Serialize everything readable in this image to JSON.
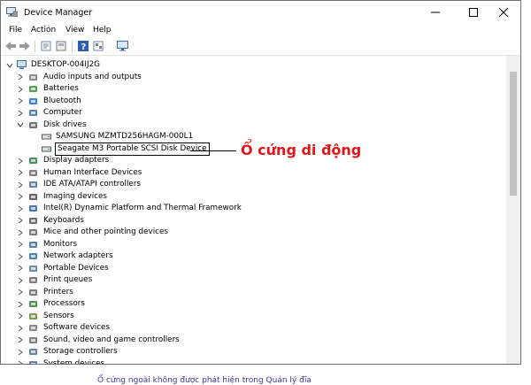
{
  "window": {
    "title": "Device Manager"
  },
  "menu": [
    "File",
    "Action",
    "View",
    "Help"
  ],
  "toolbar": {
    "buttons": [
      "back-arrow-icon",
      "forward-arrow-icon",
      "properties-icon",
      "details-icon",
      "help-icon",
      "show-hidden-icon",
      "monitor-icon"
    ]
  },
  "tree": {
    "root": "DESKTOP-004IJ2G",
    "categories": [
      {
        "label": "Audio inputs and outputs",
        "icon": "speaker-icon"
      },
      {
        "label": "Batteries",
        "icon": "battery-icon"
      },
      {
        "label": "Bluetooth",
        "icon": "bluetooth-icon"
      },
      {
        "label": "Computer",
        "icon": "computer-icon"
      },
      {
        "label": "Disk drives",
        "icon": "disk-drive-icon",
        "expanded": true,
        "children": [
          "SAMSUNG MZMTD256HAGM-000L1",
          "Seagate M3 Portable SCSI Disk Device"
        ]
      },
      {
        "label": "Display adapters",
        "icon": "display-adapter-icon"
      },
      {
        "label": "Human Interface Devices",
        "icon": "hid-icon"
      },
      {
        "label": "IDE ATA/ATAPI controllers",
        "icon": "ide-controller-icon"
      },
      {
        "label": "Imaging devices",
        "icon": "camera-icon"
      },
      {
        "label": "Intel(R) Dynamic Platform and Thermal Framework",
        "icon": "intel-icon"
      },
      {
        "label": "Keyboards",
        "icon": "keyboard-icon"
      },
      {
        "label": "Mice and other pointing devices",
        "icon": "mouse-icon"
      },
      {
        "label": "Monitors",
        "icon": "monitor-icon"
      },
      {
        "label": "Network adapters",
        "icon": "network-icon"
      },
      {
        "label": "Portable Devices",
        "icon": "portable-device-icon"
      },
      {
        "label": "Print queues",
        "icon": "printer-icon"
      },
      {
        "label": "Printers",
        "icon": "printer-icon"
      },
      {
        "label": "Processors",
        "icon": "processor-icon"
      },
      {
        "label": "Sensors",
        "icon": "sensor-icon"
      },
      {
        "label": "Software devices",
        "icon": "software-device-icon"
      },
      {
        "label": "Sound, video and game controllers",
        "icon": "sound-icon"
      },
      {
        "label": "Storage controllers",
        "icon": "storage-icon"
      },
      {
        "label": "System devices",
        "icon": "system-icon"
      }
    ],
    "selected": "Seagate M3 Portable SCSI Disk Device"
  },
  "annotation": {
    "text": "Ổ cứng di động",
    "color": "#e01515"
  },
  "caption": "Ổ cứng ngoài không được phát hiện trong Quản lý đĩa"
}
